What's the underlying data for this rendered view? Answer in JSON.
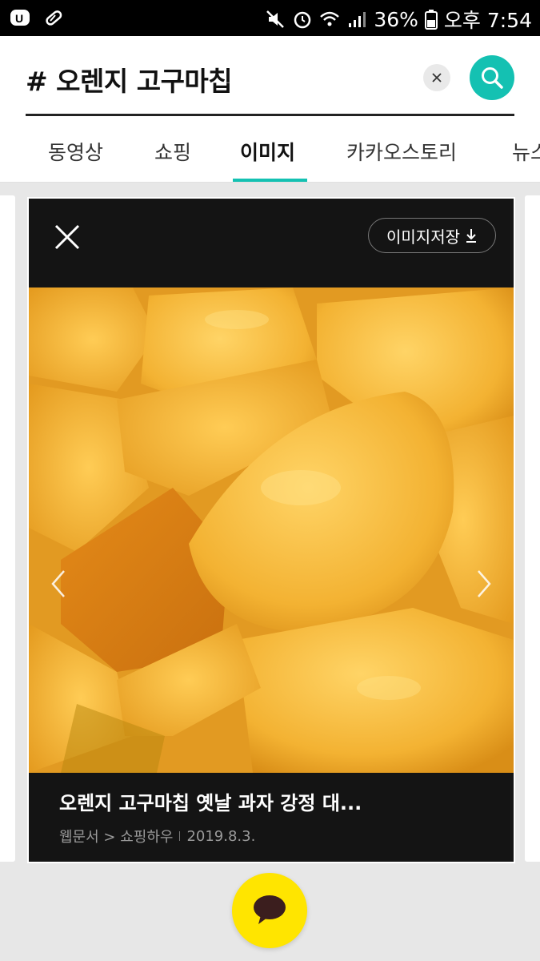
{
  "status_bar": {
    "battery": "36%",
    "time": "오후 7:54"
  },
  "search": {
    "query": "# 오렌지 고구마칩"
  },
  "tabs": [
    {
      "label": "동영상"
    },
    {
      "label": "쇼핑"
    },
    {
      "label": "이미지"
    },
    {
      "label": "카카오스토리"
    },
    {
      "label": "뉴스"
    }
  ],
  "viewer": {
    "save_label": "이미지저장",
    "title": "오렌지 고구마칩 옛날 과자 강정 대...",
    "source": "웹문서 > 쇼핑하우",
    "date": "2019.8.3."
  },
  "colors": {
    "accent": "#14c1b2",
    "chat_button": "#ffe500"
  },
  "icons": {
    "clear": "close-icon",
    "search": "search-icon",
    "close_viewer": "close-icon",
    "download": "download-icon",
    "chat": "chat-bubble-icon"
  }
}
